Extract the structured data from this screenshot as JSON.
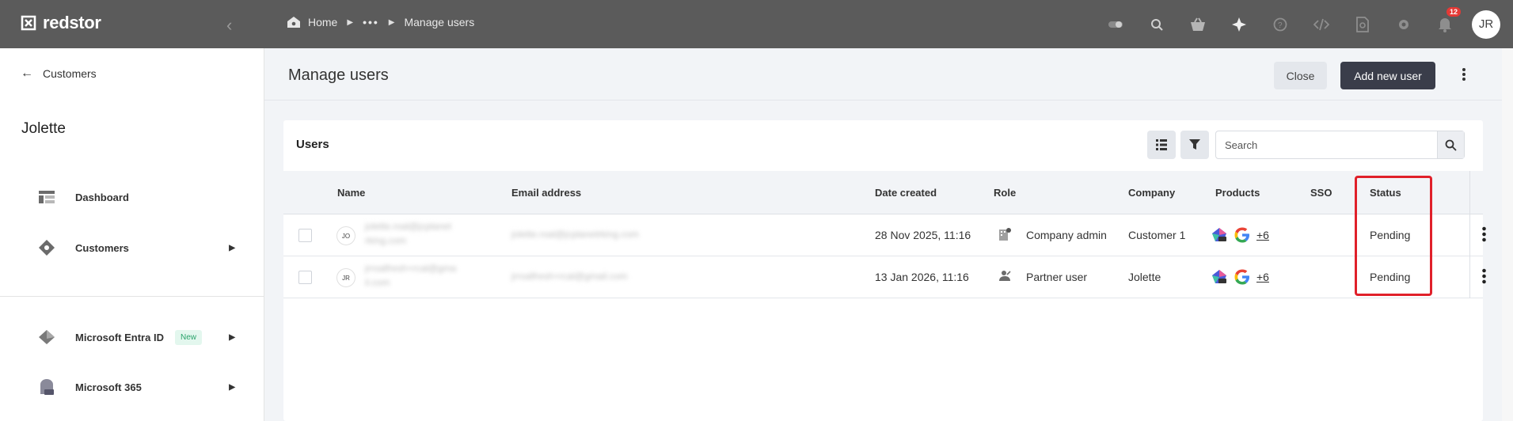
{
  "app": {
    "brand": "redstor"
  },
  "breadcrumb": {
    "home": "Home",
    "ellipsis": "•••",
    "current": "Manage users"
  },
  "topbar": {
    "notifications_count": "12",
    "user_initials": "JR",
    "icons": [
      "toggle-icon",
      "search-icon",
      "basket-icon",
      "sparkle-icon",
      "help-icon",
      "code-icon",
      "doc-search-icon",
      "gear-icon",
      "bell-icon"
    ]
  },
  "sidebar": {
    "back_label": "Customers",
    "tenant_name": "Jolette",
    "items": [
      {
        "label": "Dashboard",
        "icon": "dashboard-icon"
      },
      {
        "label": "Customers",
        "icon": "customers-icon"
      },
      {
        "label": "Microsoft Entra ID",
        "icon": "entra-icon",
        "badge": "New"
      },
      {
        "label": "Microsoft 365",
        "icon": "m365-icon"
      }
    ]
  },
  "page": {
    "title": "Manage users",
    "close_label": "Close",
    "add_label": "Add new user"
  },
  "users": {
    "card_title": "Users",
    "search_placeholder": "Search",
    "columns": [
      "Name",
      "Email address",
      "Date created",
      "Role",
      "Company",
      "Products",
      "SSO",
      "Status"
    ],
    "rows": [
      {
        "initials": "JO",
        "name_line1": "jolette.roal@jcplanet",
        "name_line2": "rking.com",
        "email": "jolette.roal@jcplanetrking.com",
        "date_created": "28 Nov 2025, 11:16",
        "role": "Company admin",
        "company": "Customer 1",
        "products_more": "+6",
        "sso": "",
        "status": "Pending"
      },
      {
        "initials": "JR",
        "name_line1": "jrroalfresh+rcal@gma",
        "name_line2": "il.com",
        "email": "jrroalfresh+rcal@gmail.com",
        "date_created": "13 Jan 2026, 11:16",
        "role": "Partner user",
        "company": "Jolette",
        "products_more": "+6",
        "sso": "",
        "status": "Pending"
      }
    ]
  },
  "colors": {
    "topbar": "#5b5b5b",
    "primary_button": "#3a3d4a",
    "highlight": "#e0202a",
    "new_badge": "#2aa36b"
  }
}
